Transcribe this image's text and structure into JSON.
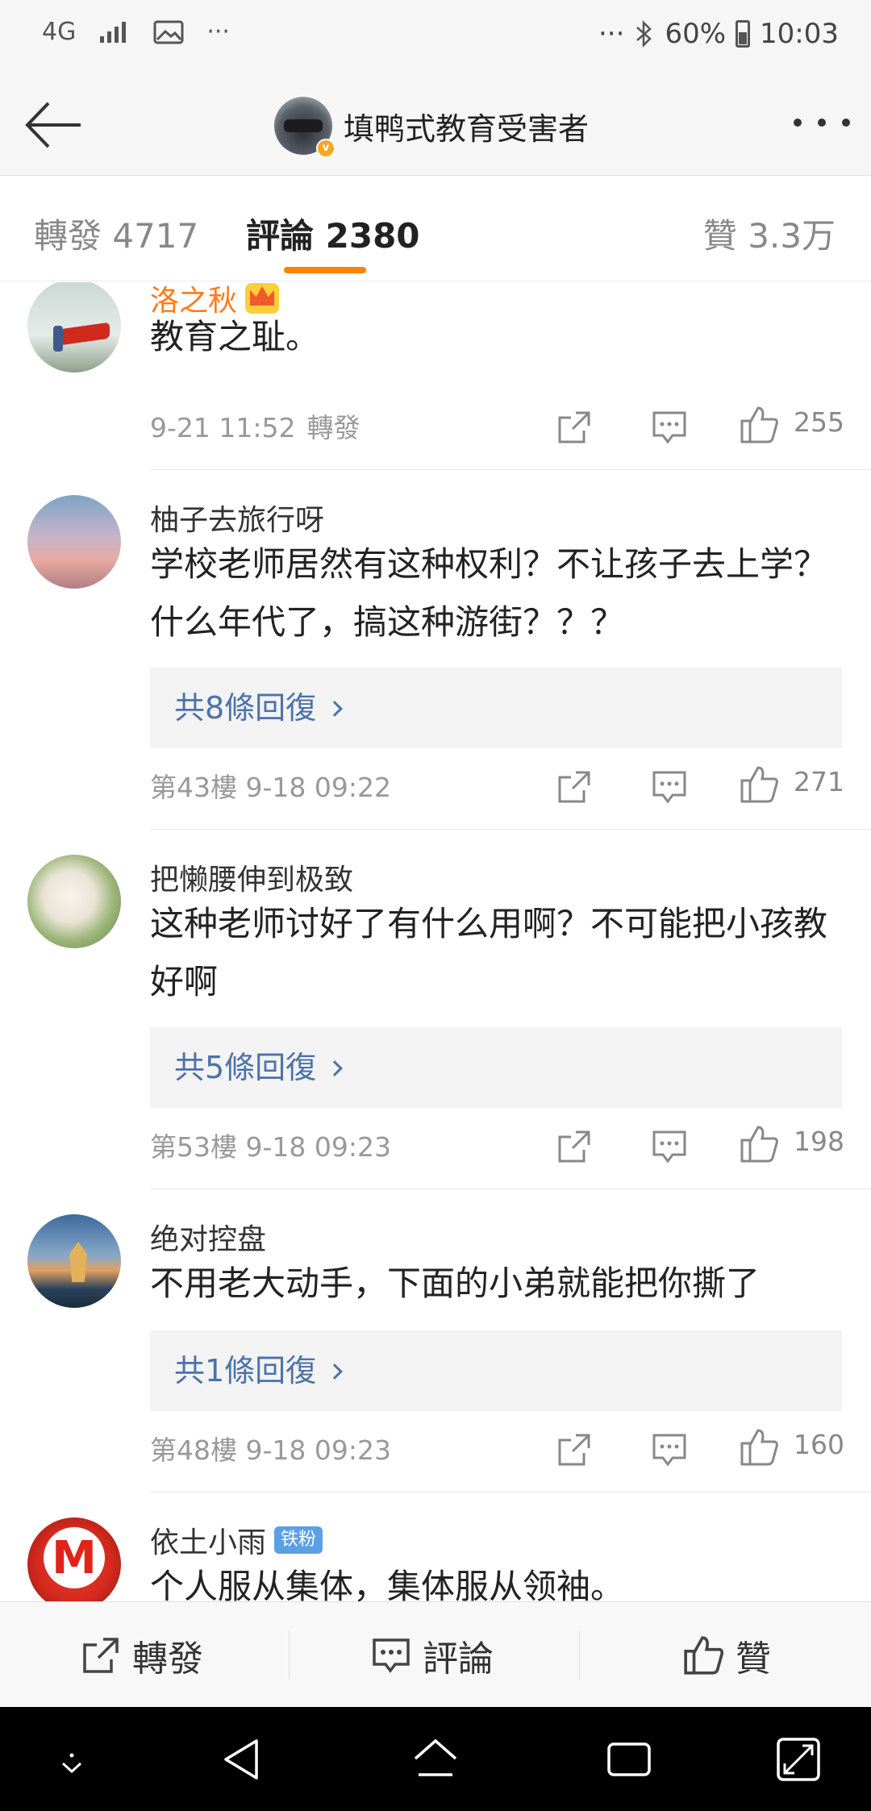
{
  "status_bar": {
    "network": "4G",
    "more": "···",
    "right_more": "···",
    "bluetooth": "bluetooth-icon",
    "battery_percent": "60%",
    "time": "10:03"
  },
  "header": {
    "title": "填鸭式教育受害者",
    "avatar_badge": "v"
  },
  "tabs": {
    "repost": "轉發 4717",
    "comment": "評論 2380",
    "like": "贊 3.3万"
  },
  "comments": [
    {
      "username": "洛之秋",
      "text": "教育之耻。",
      "date": "9-21 11:52",
      "link": "轉發",
      "likes": "255"
    },
    {
      "username": "柚子去旅行呀",
      "text": "学校老师居然有这种权利？不让孩子去上学？什么年代了，搞这种游街？？？",
      "replies": "共8條回復",
      "floor": "第43樓",
      "date": "9-18 09:22",
      "likes": "271"
    },
    {
      "username": "把懒腰伸到极致",
      "text": "这种老师讨好了有什么用啊？不可能把小孩教好啊",
      "replies": "共5條回復",
      "floor": "第53樓",
      "date": "9-18 09:23",
      "likes": "198"
    },
    {
      "username": "绝对控盘",
      "text": "不用老大动手，下面的小弟就能把你撕了",
      "replies": "共1條回復",
      "floor": "第48樓",
      "date": "9-18 09:23",
      "likes": "160"
    },
    {
      "username": "依土小雨",
      "badge": "铁粉",
      "text": "个人服从集体，集体服从领袖。"
    }
  ],
  "bottom_toolbar": {
    "repost": "轉發",
    "comment": "評論",
    "like": "贊"
  },
  "colors": {
    "accent": "#ff8200",
    "link": "#4c72a8",
    "vip_name": "#ff7a1a"
  }
}
